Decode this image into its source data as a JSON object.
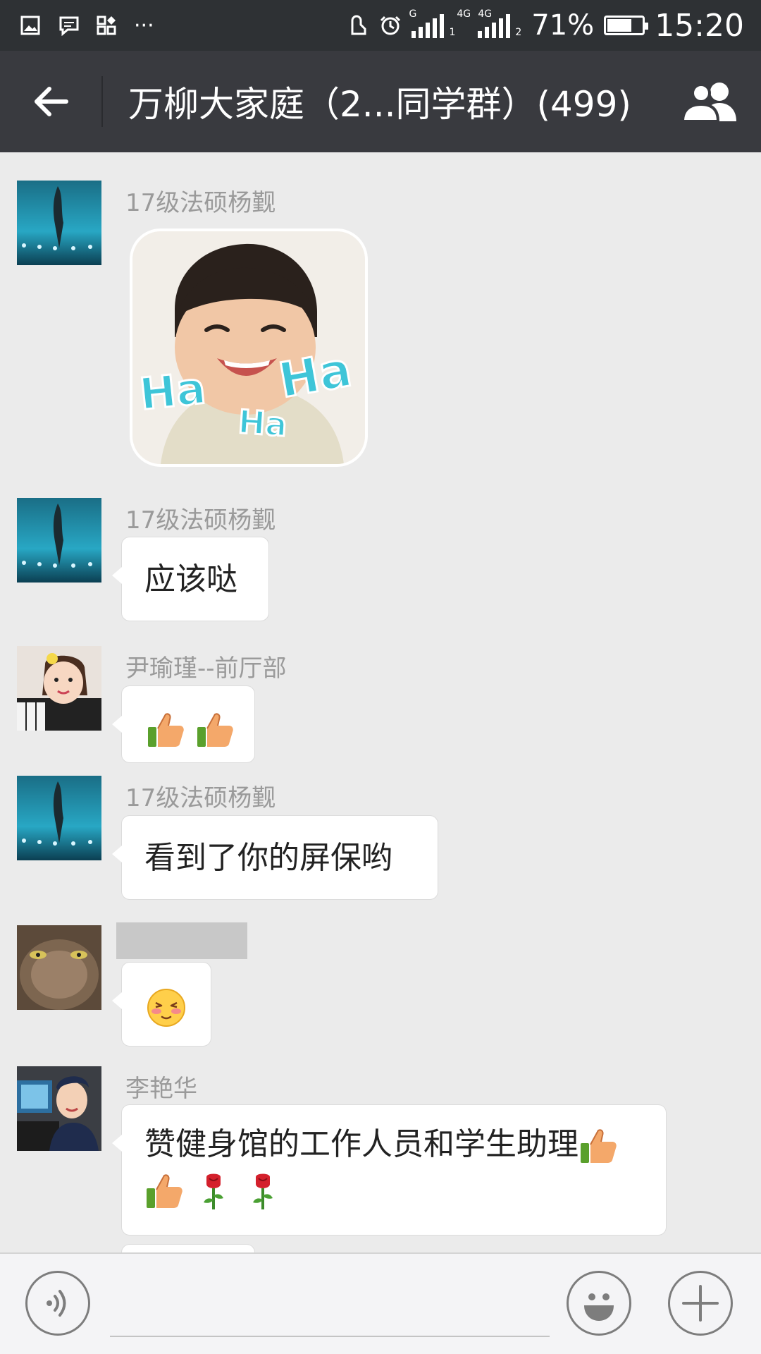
{
  "status_bar": {
    "battery_percent": "71%",
    "battery_level": 0.71,
    "time": "15:20",
    "sim1_network": "G",
    "sim1_slot": "1",
    "sim2_network": "4G",
    "sim2_network_b": "4G",
    "sim2_slot": "2",
    "more_notifications": "···"
  },
  "header": {
    "title": "万柳大家庭（2...同学群）(499)"
  },
  "messages": [
    {
      "sender": "17级法硕杨觐",
      "type": "sticker",
      "sticker_text": [
        "Ha",
        "Ha",
        "Ha"
      ]
    },
    {
      "sender": "17级法硕杨觐",
      "type": "text",
      "text": "应该哒"
    },
    {
      "sender": "尹瑜瑾--前厅部",
      "type": "emoji",
      "emoji": [
        "thumbs-up",
        "thumbs-up"
      ]
    },
    {
      "sender": "17级法硕杨觐",
      "type": "text",
      "text": "看到了你的屏保哟"
    },
    {
      "sender": "",
      "type": "emoji",
      "emoji": [
        "blushing-face"
      ]
    },
    {
      "sender": "李艳华",
      "type": "text",
      "text": "赞健身馆的工作人员和学生助理",
      "trailing_emoji": [
        "thumbs-up",
        "thumbs-up",
        "rose",
        "rose"
      ]
    }
  ],
  "input_bar": {
    "value": "",
    "placeholder": ""
  },
  "icons": {
    "back": "back-arrow-icon",
    "members": "group-members-icon",
    "voice": "voice-input-icon",
    "emoji": "emoji-icon",
    "more": "plus-icon"
  },
  "colors": {
    "titlebar": "#393a3f",
    "statusbar": "#2e3134",
    "chat_background": "#ebebeb",
    "bubble": "#ffffff",
    "nickname": "#9a9a9a",
    "sticker_text": "#3ec5d8"
  }
}
